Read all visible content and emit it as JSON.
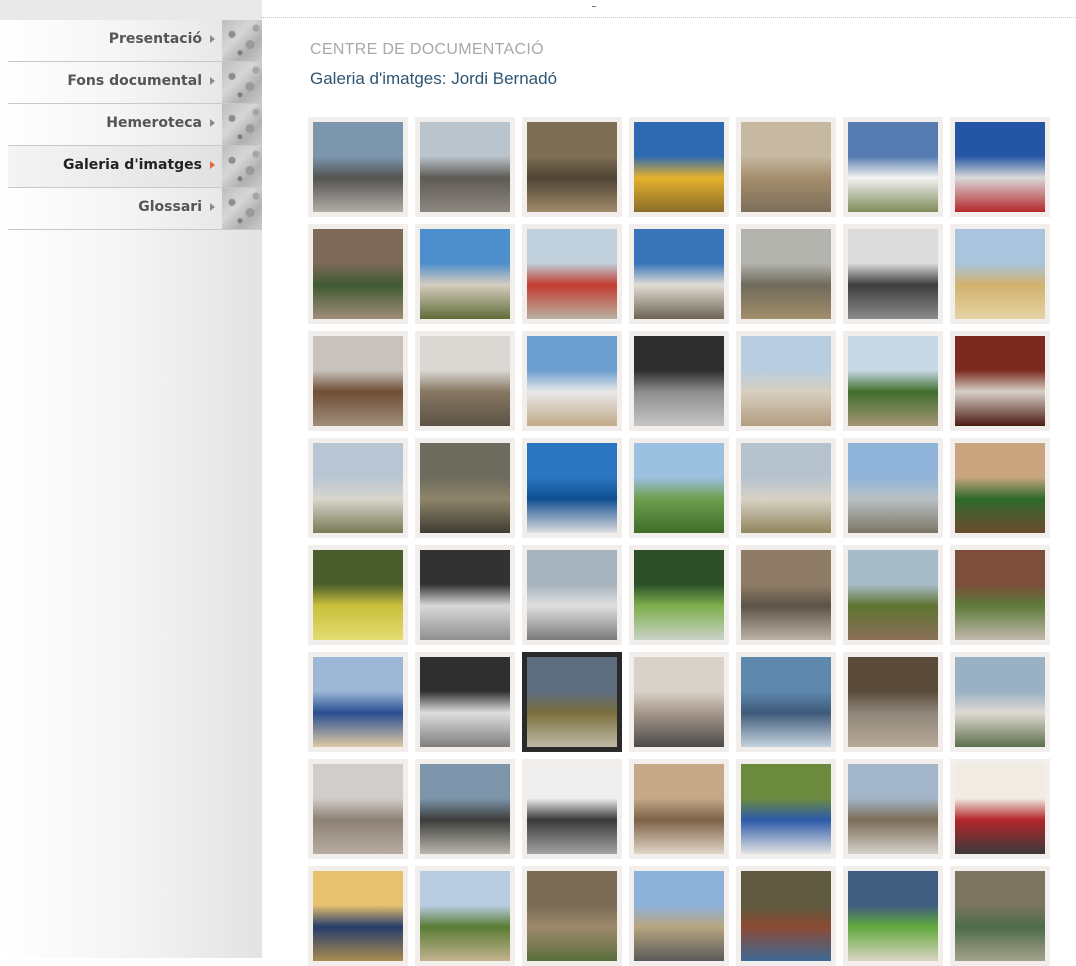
{
  "nav": {
    "items": [
      {
        "label": "Presentació",
        "active": false
      },
      {
        "label": "Fons documental",
        "active": false
      },
      {
        "label": "Hemeroteca",
        "active": false
      },
      {
        "label": "Galeria d'imatges",
        "active": true
      },
      {
        "label": "Glossari",
        "active": false
      }
    ]
  },
  "header": {
    "section": "CENTRE DE DOCUMENTACIÓ",
    "title": "Galeria d'imatges: Jordi Bernadó"
  },
  "gallery": {
    "columns": 7,
    "selected_index": 37,
    "thumbnails": [
      {
        "colors": [
          "#7b96ad",
          "#545351",
          "#b1aea6"
        ]
      },
      {
        "colors": [
          "#b9c4cc",
          "#5f5a55",
          "#8d8780"
        ]
      },
      {
        "colors": [
          "#7e6e55",
          "#4f4434",
          "#a18a6a"
        ]
      },
      {
        "colors": [
          "#2e6ab1",
          "#e5b22c",
          "#8a6d2a"
        ]
      },
      {
        "colors": [
          "#c6b8a1",
          "#a58d6c",
          "#7c6f59"
        ]
      },
      {
        "colors": [
          "#557bb0",
          "#f3f3f3",
          "#7f8a5a"
        ]
      },
      {
        "colors": [
          "#2556a5",
          "#d9d9d9",
          "#b5282c"
        ]
      },
      {
        "colors": [
          "#7e6a58",
          "#3e5a33",
          "#a08c77"
        ]
      },
      {
        "colors": [
          "#4d8fcc",
          "#d5cdbf",
          "#5f6b37"
        ]
      },
      {
        "colors": [
          "#c0d0dd",
          "#c23b2f",
          "#b9b0a2"
        ]
      },
      {
        "colors": [
          "#3774b8",
          "#e0dcd5",
          "#6d6452"
        ]
      },
      {
        "colors": [
          "#b3b3ae",
          "#6f6b5b",
          "#a28e6a"
        ]
      },
      {
        "colors": [
          "#dcdcdc",
          "#3d3d3d",
          "#8b8b8b"
        ]
      },
      {
        "colors": [
          "#a9c4dc",
          "#d2b26e",
          "#e5d4a4"
        ]
      },
      {
        "colors": [
          "#c7c2bc",
          "#6f4e34",
          "#9f8e7b"
        ]
      },
      {
        "colors": [
          "#d9d8d3",
          "#877762",
          "#5c5245"
        ]
      },
      {
        "colors": [
          "#6b9fcf",
          "#e8e8e8",
          "#c1aa88"
        ]
      },
      {
        "colors": [
          "#2e2e2e",
          "#8d8d8d",
          "#c5c5c5"
        ]
      },
      {
        "colors": [
          "#b9cde0",
          "#d8cfc0",
          "#b29d80"
        ]
      },
      {
        "colors": [
          "#c8d8e5",
          "#3f6e2c",
          "#a59576"
        ]
      },
      {
        "colors": [
          "#7a2a1f",
          "#d7d0c6",
          "#4b1b14"
        ]
      },
      {
        "colors": [
          "#b8c6d4",
          "#d8d5cc",
          "#7a7a56"
        ]
      },
      {
        "colors": [
          "#6c6b5e",
          "#8e8469",
          "#3f3d33"
        ]
      },
      {
        "colors": [
          "#2b76c0",
          "#0f4e8f",
          "#dedede"
        ]
      },
      {
        "colors": [
          "#9cc0e0",
          "#6e9e4d",
          "#3e6d2a"
        ]
      },
      {
        "colors": [
          "#b6c3cf",
          "#d7d2c4",
          "#91855d"
        ]
      },
      {
        "colors": [
          "#8fb3d9",
          "#b9c1c4",
          "#7c7566"
        ]
      },
      {
        "colors": [
          "#c8a57e",
          "#2e6a2c",
          "#6d4b2f"
        ]
      },
      {
        "colors": [
          "#4a5e2c",
          "#c9c03b",
          "#e2dc72"
        ]
      },
      {
        "colors": [
          "#323232",
          "#d8d8d8",
          "#8f8f8f"
        ]
      },
      {
        "colors": [
          "#a7b3bc",
          "#e0e0e0",
          "#7a7a7a"
        ]
      },
      {
        "colors": [
          "#2c4f2a",
          "#7cae4c",
          "#c9d2c6"
        ]
      },
      {
        "colors": [
          "#8f7c66",
          "#5c5447",
          "#bdb3a5"
        ]
      },
      {
        "colors": [
          "#a6bcc8",
          "#5f7431",
          "#8a6f58"
        ]
      },
      {
        "colors": [
          "#7c4e3b",
          "#5d7a3a",
          "#c2b8ab"
        ]
      },
      {
        "colors": [
          "#9cb8d6",
          "#294e92",
          "#dcc9a3"
        ]
      },
      {
        "colors": [
          "#2f2f2f",
          "#dedede",
          "#7e7e7e"
        ]
      },
      {
        "colors": [
          "#5d6e80",
          "#7a6f3d",
          "#c0b9a8"
        ]
      },
      {
        "colors": [
          "#d9d2c9",
          "#a6978a",
          "#4b4b4b"
        ]
      },
      {
        "colors": [
          "#5f88ad",
          "#3e5a7a",
          "#c6d3dd"
        ]
      },
      {
        "colors": [
          "#5a4b3a",
          "#8f8679",
          "#b5a998"
        ]
      },
      {
        "colors": [
          "#9ab1c3",
          "#dedad2",
          "#5d6f4c"
        ]
      },
      {
        "colors": [
          "#d0cdca",
          "#8d8174",
          "#b7ada1"
        ]
      },
      {
        "colors": [
          "#7c95ab",
          "#3c3d3b",
          "#b9b6ad"
        ]
      },
      {
        "colors": [
          "#eeeeee",
          "#3a3a3a",
          "#a3a3a3"
        ]
      },
      {
        "colors": [
          "#c5a887",
          "#7d6148",
          "#e0d6c6"
        ]
      },
      {
        "colors": [
          "#6c8a3e",
          "#2c5aa9",
          "#e3e3e3"
        ]
      },
      {
        "colors": [
          "#a3b5c8",
          "#7b6d57",
          "#d4d0ca"
        ]
      },
      {
        "colors": [
          "#f0ece4",
          "#b3252a",
          "#3a3a3a"
        ]
      },
      {
        "colors": [
          "#e6c170",
          "#263c6a",
          "#a98c52"
        ]
      },
      {
        "colors": [
          "#b9cde2",
          "#5a7c34",
          "#c3b28f"
        ]
      },
      {
        "colors": [
          "#7a6b55",
          "#9e8a6d",
          "#5a6e3a"
        ]
      },
      {
        "colors": [
          "#8db2d9",
          "#b8a57f",
          "#5a5a5a"
        ]
      },
      {
        "colors": [
          "#5f5a3f",
          "#8c4a33",
          "#3e6a96"
        ]
      },
      {
        "colors": [
          "#3f5d7e",
          "#62a93d",
          "#d9d4c4"
        ]
      },
      {
        "colors": [
          "#7b7560",
          "#4d6b4a",
          "#a5a28e"
        ]
      }
    ]
  }
}
